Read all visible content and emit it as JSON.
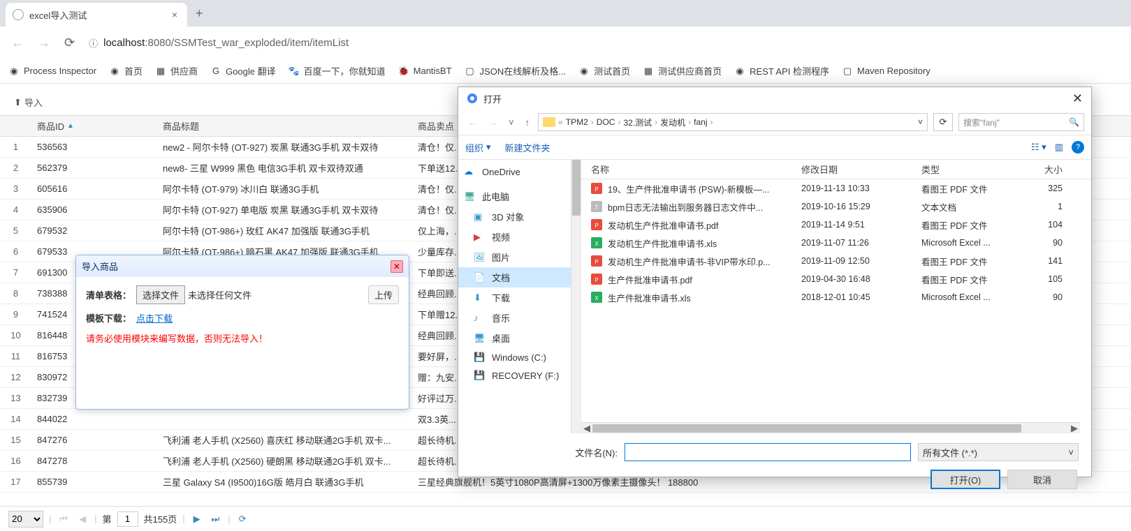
{
  "browser": {
    "tab_title": "excel导入测试",
    "url_display_prefix": "localhost",
    "url_display_suffix": ":8080/SSMTest_war_exploded/item/itemList"
  },
  "bookmarks": [
    {
      "label": "Process Inspector"
    },
    {
      "label": "首页"
    },
    {
      "label": "供应商"
    },
    {
      "label": "Google 翻译"
    },
    {
      "label": "百度一下，你就知道"
    },
    {
      "label": "MantisBT"
    },
    {
      "label": "JSON在线解析及格..."
    },
    {
      "label": "测试首页"
    },
    {
      "label": "测试供应商首页"
    },
    {
      "label": "REST API 检测程序"
    },
    {
      "label": "Maven Repository"
    }
  ],
  "toolbar": {
    "import": "导入"
  },
  "grid_headers": {
    "id": "商品ID",
    "title": "商品标题",
    "sell": "商品卖点"
  },
  "grid_rows": [
    {
      "no": 1,
      "id": "536563",
      "title": "new2 - 阿尔卡特 (OT-927) 炭黑 联通3G手机 双卡双待",
      "sell": "清仓！仅..."
    },
    {
      "no": 2,
      "id": "562379",
      "title": "new8- 三星 W999 黑色 电信3G手机 双卡双待双通",
      "sell": "下单送12..."
    },
    {
      "no": 3,
      "id": "605616",
      "title": "阿尔卡特 (OT-979) 冰川白 联通3G手机",
      "sell": "清仓！仅..."
    },
    {
      "no": 4,
      "id": "635906",
      "title": "阿尔卡特 (OT-927) 单电版 炭黑 联通3G手机 双卡双待",
      "sell": "清仓！仅..."
    },
    {
      "no": 5,
      "id": "679532",
      "title": "阿尔卡特 (OT-986+) 玫红 AK47 加强版 联通3G手机",
      "sell": "仅上海，..."
    },
    {
      "no": 6,
      "id": "679533",
      "title": "阿尔卡特 (OT-986+) 暗石黑 AK47 加强版 联通3G手机",
      "sell": "少量库存..."
    },
    {
      "no": 7,
      "id": "691300",
      "title": "",
      "sell": "下单即送..."
    },
    {
      "no": 8,
      "id": "738388",
      "title": "",
      "sell": "经典回顾..."
    },
    {
      "no": 9,
      "id": "741524",
      "title": "",
      "sell": "下单赠12..."
    },
    {
      "no": 10,
      "id": "816448",
      "title": "",
      "sell": "经典回顾..."
    },
    {
      "no": 11,
      "id": "816753",
      "title": "",
      "sell": "要好屏，..."
    },
    {
      "no": 12,
      "id": "830972",
      "title": "",
      "sell": "赠：九安..."
    },
    {
      "no": 13,
      "id": "832739",
      "title": "",
      "sell": "好评过万..."
    },
    {
      "no": 14,
      "id": "844022",
      "title": "",
      "sell": "双3.3英..."
    },
    {
      "no": 15,
      "id": "847276",
      "title": "飞利浦 老人手机 (X2560) 喜庆红 移动联通2G手机 双卡...",
      "sell": "超长待机..."
    },
    {
      "no": 16,
      "id": "847278",
      "title": "飞利浦 老人手机 (X2560) 硬朗黑 移动联通2G手机 双卡...",
      "sell": "超长待机..."
    },
    {
      "no": 17,
      "id": "855739",
      "title": "三星 Galaxy S4 (I9500)16G版 皓月白 联通3G手机",
      "sell": "三星经典旗舰机！5英寸1080P高清屏+1300万像素主摄像头！    188800"
    }
  ],
  "pagination": {
    "page_size": "20",
    "page_label": "第",
    "page_value": "1",
    "total_label": "共155页"
  },
  "dialog": {
    "title": "导入商品",
    "form_label": "清单表格：",
    "file_btn": "选择文件",
    "file_text": "未选择任何文件",
    "upload": "上传",
    "template_label": "模板下载：",
    "template_link": "点击下载",
    "warning": "请务必使用模块来编写数据，否则无法导入！"
  },
  "file_dialog": {
    "title": "打开",
    "breadcrumb": [
      "TPM2",
      "DOC",
      "32.测试",
      "发动机",
      "fanj"
    ],
    "search_placeholder": "搜索\"fanj\"",
    "organize": "组织",
    "new_folder": "新建文件夹",
    "sidebar": {
      "onedrive": "OneDrive",
      "this_pc": "此电脑",
      "objects3d": "3D 对象",
      "videos": "视频",
      "pictures": "图片",
      "documents": "文档",
      "downloads": "下载",
      "music": "音乐",
      "desktop": "桌面",
      "windows_c": "Windows (C:)",
      "recovery_f": "RECOVERY (F:)"
    },
    "columns": {
      "name": "名称",
      "date": "修改日期",
      "type": "类型",
      "size": "大小"
    },
    "files": [
      {
        "name": "19、生产件批准申请书 (PSW)-新模板—...",
        "date": "2019-11-13 10:33",
        "type": "看图王 PDF 文件",
        "size": "325",
        "icon": "pdf"
      },
      {
        "name": "bpm日志无法输出到服务器日志文件中...",
        "date": "2019-10-16 15:29",
        "type": "文本文档",
        "size": "1",
        "icon": "txt"
      },
      {
        "name": "发动机生产件批准申请书.pdf",
        "date": "2019-11-14 9:51",
        "type": "看图王 PDF 文件",
        "size": "104",
        "icon": "pdf"
      },
      {
        "name": "发动机生产件批准申请书.xls",
        "date": "2019-11-07 11:26",
        "type": "Microsoft Excel ...",
        "size": "90",
        "icon": "xls"
      },
      {
        "name": "发动机生产件批准申请书-非VIP带水印.p...",
        "date": "2019-11-09 12:50",
        "type": "看图王 PDF 文件",
        "size": "141",
        "icon": "pdf"
      },
      {
        "name": "生产件批准申请书.pdf",
        "date": "2019-04-30 16:48",
        "type": "看图王 PDF 文件",
        "size": "105",
        "icon": "pdf"
      },
      {
        "name": "生产件批准申请书.xls",
        "date": "2018-12-01 10:45",
        "type": "Microsoft Excel ...",
        "size": "90",
        "icon": "xls"
      }
    ],
    "filename_label": "文件名(N):",
    "filetype": "所有文件 (*.*)",
    "open_btn": "打开(O)",
    "cancel_btn": "取消"
  }
}
